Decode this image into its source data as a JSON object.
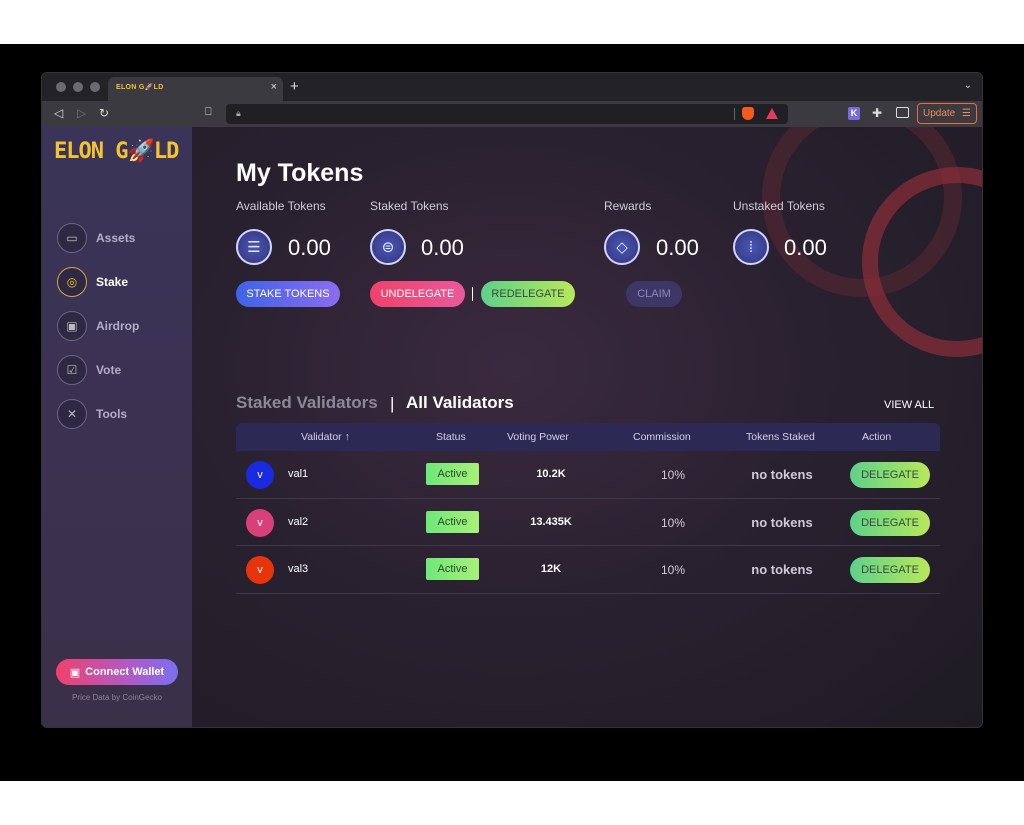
{
  "browser": {
    "tab_title": "ELON G🚀LD",
    "update_label": "Update"
  },
  "sidebar": {
    "logo": "ELON G🚀LD",
    "items": [
      {
        "label": "Assets",
        "icon": "wallet-icon",
        "active": false
      },
      {
        "label": "Stake",
        "icon": "coins-icon",
        "active": true
      },
      {
        "label": "Airdrop",
        "icon": "gift-icon",
        "active": false
      },
      {
        "label": "Vote",
        "icon": "ballot-icon",
        "active": false
      },
      {
        "label": "Tools",
        "icon": "tools-icon",
        "active": false
      }
    ],
    "connect_wallet": "Connect Wallet",
    "price_note": "Price Data by CoinGecko"
  },
  "main": {
    "title": "My Tokens",
    "tokens": [
      {
        "label": "Available Tokens",
        "value": "0.00",
        "icon": "coin-stack-icon"
      },
      {
        "label": "Staked Tokens",
        "value": "0.00",
        "icon": "staked-coin-icon"
      },
      {
        "label": "Rewards",
        "value": "0.00",
        "icon": "diamond-icon"
      },
      {
        "label": "Unstaked Tokens",
        "value": "0.00",
        "icon": "unstaked-coin-icon"
      }
    ],
    "buttons": {
      "stake": "STAKE TOKENS",
      "undelegate": "UNDELEGATE",
      "redelegate": "REDELEGATE",
      "claim": "CLAIM"
    },
    "validators": {
      "tab_staked": "Staked Validators",
      "tab_all": "All Validators",
      "view_all": "VIEW ALL",
      "columns": [
        "Validator ↑",
        "Status",
        "Voting Power",
        "Commission",
        "Tokens Staked",
        "Action"
      ],
      "rows": [
        {
          "avatar": "v",
          "avatar_color": "#1a2ae0",
          "name": "val1",
          "status": "Active",
          "voting_power": "10.2K",
          "commission": "10%",
          "tokens_staked": "no tokens",
          "action": "DELEGATE"
        },
        {
          "avatar": "v",
          "avatar_color": "#d8407a",
          "name": "val2",
          "status": "Active",
          "voting_power": "13.435K",
          "commission": "10%",
          "tokens_staked": "no tokens",
          "action": "DELEGATE"
        },
        {
          "avatar": "v",
          "avatar_color": "#e8340a",
          "name": "val3",
          "status": "Active",
          "voting_power": "12K",
          "commission": "10%",
          "tokens_staked": "no tokens",
          "action": "DELEGATE"
        }
      ]
    }
  }
}
